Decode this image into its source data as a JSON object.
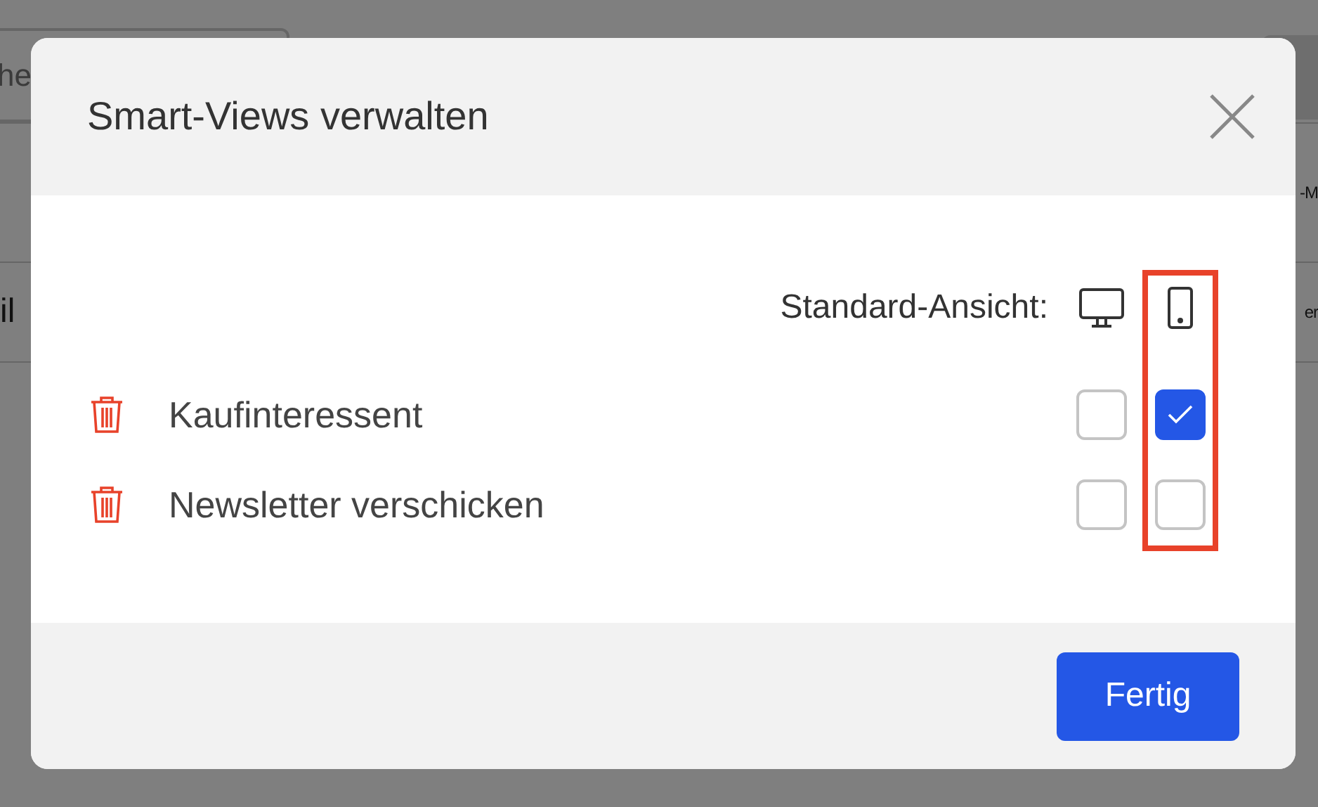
{
  "background": {
    "search": {
      "placeholder": "he"
    },
    "table": {
      "columns": [
        "",
        "-M"
      ],
      "rows": [
        [
          "il",
          "er"
        ]
      ]
    }
  },
  "dialog": {
    "title": "Smart-Views verwalten",
    "standard_view": {
      "label": "Standard-Ansicht:",
      "columns": [
        {
          "kind": "desktop",
          "highlighted": false
        },
        {
          "kind": "mobile",
          "highlighted": true
        }
      ]
    },
    "views": [
      {
        "name": "Kaufinteressent",
        "desktop": false,
        "mobile": true
      },
      {
        "name": "Newsletter verschicken",
        "desktop": false,
        "mobile": false
      }
    ],
    "buttons": [
      {
        "label": "Fertig"
      }
    ]
  }
}
